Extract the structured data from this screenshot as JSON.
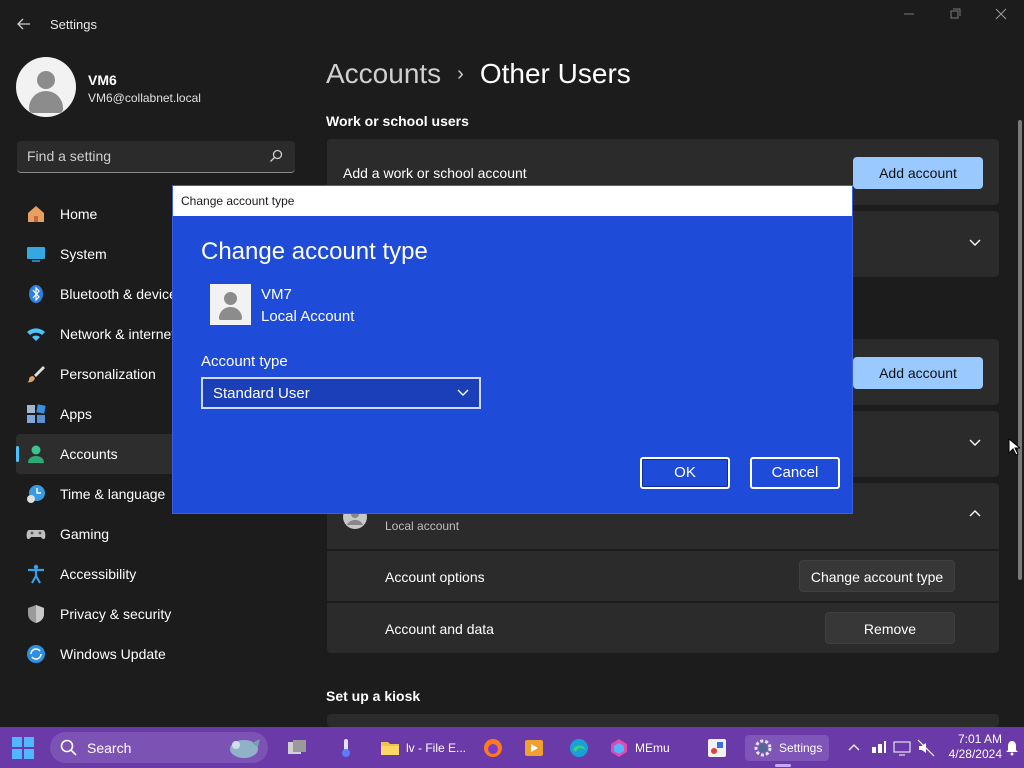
{
  "window": {
    "title": "Settings",
    "back_icon": "back-arrow-icon",
    "controls": [
      "minimize-icon",
      "maximize-icon",
      "close-icon"
    ]
  },
  "profile": {
    "name": "VM6",
    "email": "VM6@collabnet.local"
  },
  "search": {
    "placeholder": "Find a setting"
  },
  "sidebar": {
    "items": [
      {
        "label": "Home",
        "icon": "home-icon",
        "color": "#e8a060"
      },
      {
        "label": "System",
        "icon": "system-icon",
        "color": "#35a8e0"
      },
      {
        "label": "Bluetooth & devices",
        "icon": "bluetooth-icon",
        "color": "#2f7fe0"
      },
      {
        "label": "Network & internet",
        "icon": "network-icon",
        "color": "#4cc2ff"
      },
      {
        "label": "Personalization",
        "icon": "brush-icon",
        "color": "#e0a060"
      },
      {
        "label": "Apps",
        "icon": "apps-icon",
        "color": "#7fb0e0"
      },
      {
        "label": "Accounts",
        "icon": "accounts-icon",
        "color": "#3ec28f",
        "active": true
      },
      {
        "label": "Time & language",
        "icon": "time-language-icon",
        "color": "#3a9be0"
      },
      {
        "label": "Gaming",
        "icon": "gaming-icon",
        "color": "#bfbfbf"
      },
      {
        "label": "Accessibility",
        "icon": "accessibility-icon",
        "color": "#3aa0e8"
      },
      {
        "label": "Privacy & security",
        "icon": "shield-icon",
        "color": "#9a9a9a"
      },
      {
        "label": "Windows Update",
        "icon": "update-icon",
        "color": "#2f8fe0"
      }
    ]
  },
  "main": {
    "breadcrumb": {
      "parent": "Accounts",
      "separator": "›",
      "current": "Other Users"
    },
    "work_school": {
      "section_title": "Work or school users",
      "add_label": "Add a work or school account",
      "add_button": "Add account"
    },
    "other_users": {
      "add_button": "Add account",
      "user_subtitle": "Local account",
      "account_options_label": "Account options",
      "change_type_button": "Change account type",
      "account_data_label": "Account and data",
      "remove_button": "Remove"
    },
    "kiosk": {
      "section_title": "Set up a kiosk"
    }
  },
  "dialog": {
    "window_title": "Change account type",
    "heading": "Change account type",
    "user_name": "VM7",
    "user_type": "Local Account",
    "field_label": "Account type",
    "selected_value": "Standard User",
    "ok_button": "OK",
    "cancel_button": "Cancel"
  },
  "taskbar": {
    "search_text": "Search",
    "apps": [
      {
        "label": "",
        "icon": "task-view-icon"
      },
      {
        "label": "",
        "icon": "thermometer-icon"
      },
      {
        "label": "lv - File E...",
        "icon": "file-explorer-icon"
      },
      {
        "label": "",
        "icon": "firefox-icon"
      },
      {
        "label": "",
        "icon": "media-player-icon"
      },
      {
        "label": "",
        "icon": "edge-icon"
      },
      {
        "label": "MEmu",
        "icon": "memu-icon"
      },
      {
        "label": "",
        "icon": "snipping-tool-icon"
      },
      {
        "label": "Settings",
        "icon": "settings-gear-icon",
        "active": true
      }
    ],
    "time": "7:01 AM",
    "date": "4/28/2024"
  }
}
